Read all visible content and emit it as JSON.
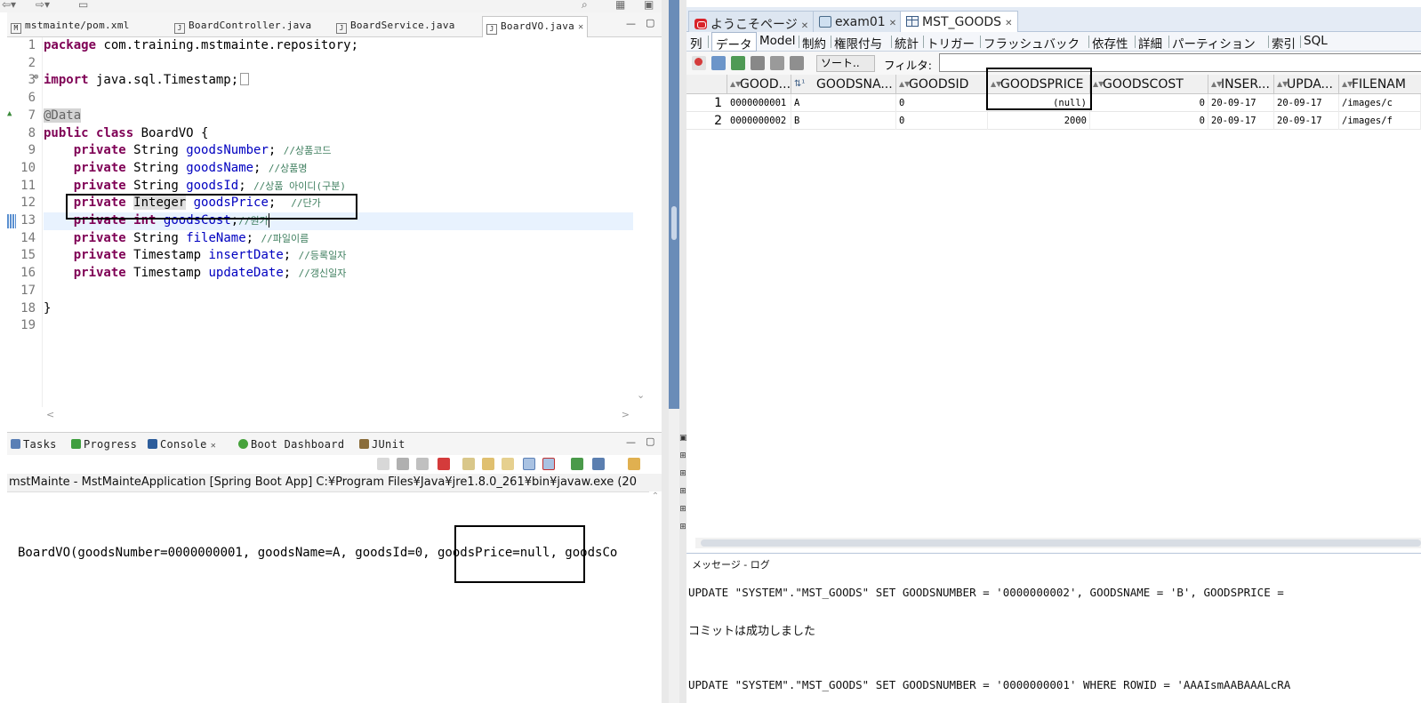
{
  "eclipse": {
    "editor_tabs": [
      {
        "icon": "maven-pom-icon",
        "label": "mstmainte/pom.xml"
      },
      {
        "icon": "java-file-icon",
        "label": "BoardController.java"
      },
      {
        "icon": "java-file-icon",
        "label": "BoardService.java"
      },
      {
        "icon": "java-file-icon",
        "label": "BoardVO.java",
        "active": true
      }
    ],
    "code": {
      "line_numbers": [
        "1",
        "2",
        "3",
        "6",
        "7",
        "8",
        "9",
        "10",
        "11",
        "12",
        "13",
        "14",
        "15",
        "16",
        "17",
        "18",
        "19"
      ],
      "l1": {
        "kw": "package",
        "rest": " com.training.mstmainte.repository;"
      },
      "l3": {
        "kw": "import",
        "rest": " java.sql.Timestamp;"
      },
      "l7": {
        "ann": "@Data"
      },
      "l8": {
        "kw1": "public",
        "kw2": "class",
        "rest": " BoardVO {"
      },
      "fields": [
        {
          "mod": "private",
          "type": "String",
          "name": "goodsNumber",
          "comment": "//상품코드"
        },
        {
          "mod": "private",
          "type": "String",
          "name": "goodsName",
          "comment": "//상품명"
        },
        {
          "mod": "private",
          "type": "String",
          "name": "goodsId",
          "comment": "//상품 아이디(구분)"
        },
        {
          "mod": "private",
          "type": "Integer",
          "name": "goodsPrice",
          "comment": "//단가"
        },
        {
          "mod": "private",
          "type": "int",
          "name": "goodsCost",
          "comment": "//원가"
        },
        {
          "mod": "private",
          "type": "String",
          "name": "fileName",
          "comment": "//파일이름"
        },
        {
          "mod": "private",
          "type": "Timestamp",
          "name": "insertDate",
          "comment": "//등록일자"
        },
        {
          "mod": "private",
          "type": "Timestamp",
          "name": "updateDate",
          "comment": "//갱신일자"
        }
      ],
      "l18": "}"
    },
    "bottom_tabs": [
      {
        "label": "Tasks",
        "color": "#5a7fb5"
      },
      {
        "label": "Progress",
        "color": "#3f9e3f"
      },
      {
        "label": "Console",
        "color": "#2d5d9b",
        "active": true
      },
      {
        "label": "Boot Dashboard",
        "color": "#46a23b"
      },
      {
        "label": "JUnit",
        "color": "#8a6d3b"
      }
    ],
    "console_header": "mstMainte - MstMainteApplication [Spring Boot App] C:¥Program Files¥Java¥jre1.8.0_261¥bin¥javaw.exe  (20",
    "console_output": "BoardVO(goodsNumber=0000000001, goodsName=A, goodsId=0, goodsPrice=null, goodsCo"
  },
  "sqldev": {
    "doc_tabs": [
      {
        "icon": "oracle-icon",
        "label": "ようこそページ"
      },
      {
        "icon": "sql-worksheet-icon",
        "label": "exam01"
      },
      {
        "icon": "table-icon",
        "label": "MST_GOODS",
        "active": true
      }
    ],
    "sub_tabs": [
      "列",
      "データ",
      "Model",
      "制約",
      "権限付与",
      "統計",
      "トリガー",
      "フラッシュバック",
      "依存性",
      "詳細",
      "パーティション",
      "索引",
      "SQL"
    ],
    "active_sub_tab": "データ",
    "sort_label": "ソート..",
    "filter_label": "フィルタ:",
    "filter_value": "",
    "columns": [
      "GOOD...",
      "GOODSNA...",
      "GOODSID",
      "GOODSPRICE",
      "GOODSCOST",
      "INSER...",
      "UPDA...",
      "FILENAM"
    ],
    "rows": [
      {
        "num": "1",
        "cells": [
          "0000000001",
          "A",
          "0",
          "(null)",
          "0",
          "20-09-17",
          "20-09-17",
          "/images/c"
        ]
      },
      {
        "num": "2",
        "cells": [
          "0000000002",
          "B",
          "0",
          "2000",
          "0",
          "20-09-17",
          "20-09-17",
          "/images/f"
        ]
      }
    ],
    "message_title": "メッセージ - ログ",
    "messages": [
      "UPDATE \"SYSTEM\".\"MST_GOODS\" SET GOODSNUMBER = '0000000002', GOODSNAME = 'B', GOODSPRICE =",
      "コミットは成功しました",
      "UPDATE \"SYSTEM\".\"MST_GOODS\" SET GOODSNUMBER = '0000000001' WHERE ROWID = 'AAAIsmAABAAALcRA"
    ]
  }
}
